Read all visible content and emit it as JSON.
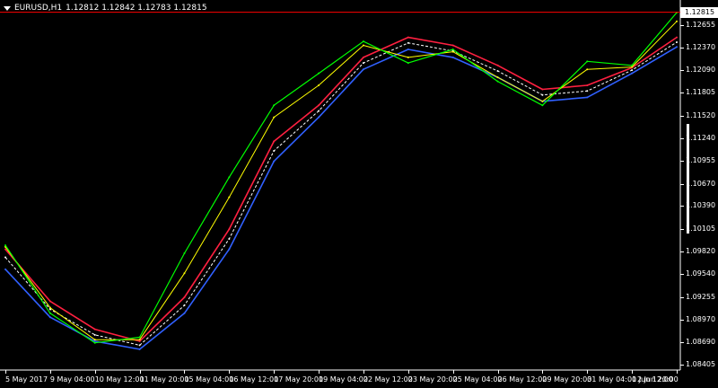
{
  "window": {
    "title": "EURUSD,H1",
    "ohlc": "1.12812 1.12842 1.12783 1.12815"
  },
  "current_price": "1.12815",
  "price_scale": [
    "1.12655",
    "1.12370",
    "1.12090",
    "1.11805",
    "1.11520",
    "1.11240",
    "1.10955",
    "1.10670",
    "1.10390",
    "1.10105",
    "1.09820",
    "1.09540",
    "1.09255",
    "1.08970",
    "1.08690",
    "1.08405"
  ],
  "time_axis": [
    "5 May 2017",
    "9 May 04:00",
    "10 May 12:00",
    "11 May 20:00",
    "15 May 04:00",
    "16 May 12:00",
    "17 May 20:00",
    "19 May 04:00",
    "22 May 12:00",
    "23 May 20:00",
    "25 May 04:00",
    "26 May 12:00",
    "29 May 20:00",
    "31 May 04:00",
    "1 Jun 12:00",
    "2 Jun 20:00"
  ],
  "colors": {
    "background": "#000000",
    "price_line": "#00ff00",
    "band_upper": "#ff2040",
    "band_lower": "#3060ff",
    "band_mid": "#ffffff",
    "ma_fast": "#ffff00",
    "current_line": "#ff0000"
  },
  "chart_data": {
    "type": "line",
    "symbol": "EURUSD",
    "timeframe": "H1",
    "ylim": [
      1.0834,
      1.129
    ],
    "x": [
      "5 May 2017",
      "9 May 04:00",
      "10 May 12:00",
      "11 May 20:00",
      "15 May 04:00",
      "16 May 12:00",
      "17 May 20:00",
      "19 May 04:00",
      "22 May 12:00",
      "23 May 20:00",
      "25 May 04:00",
      "26 May 12:00",
      "29 May 20:00",
      "31 May 04:00",
      "1 Jun 12:00",
      "2 Jun 20:00"
    ],
    "series": [
      {
        "values": [
          1.099,
          1.0905,
          1.0868,
          1.0875,
          1.098,
          1.1075,
          1.1165,
          1.1205,
          1.1245,
          1.1218,
          1.1235,
          1.1195,
          1.1165,
          1.122,
          1.1215,
          1.1281
        ]
      },
      {
        "values": [
          1.0985,
          1.092,
          1.0885,
          1.087,
          1.0925,
          1.101,
          1.112,
          1.1165,
          1.1225,
          1.125,
          1.124,
          1.1215,
          1.1185,
          1.119,
          1.1212,
          1.125
        ]
      },
      {
        "values": [
          1.096,
          1.09,
          1.087,
          1.086,
          1.0905,
          1.0985,
          1.1095,
          1.115,
          1.121,
          1.1235,
          1.1225,
          1.12,
          1.117,
          1.1175,
          1.1205,
          1.1238
        ]
      },
      {
        "values": [
          1.0975,
          1.091,
          1.0878,
          1.0865,
          1.0915,
          1.0998,
          1.1108,
          1.1158,
          1.1218,
          1.1243,
          1.1233,
          1.1208,
          1.1178,
          1.1183,
          1.1209,
          1.1244
        ]
      },
      {
        "values": [
          1.0988,
          1.0912,
          1.0872,
          1.0872,
          1.0955,
          1.105,
          1.115,
          1.119,
          1.124,
          1.1225,
          1.1232,
          1.12,
          1.117,
          1.121,
          1.1213,
          1.127
        ]
      }
    ]
  }
}
